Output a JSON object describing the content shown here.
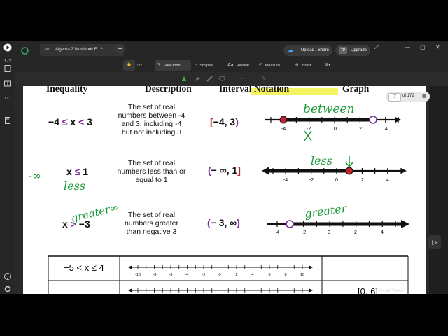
{
  "tab": {
    "title": "Algebra 2 Workbook F... *"
  },
  "actions": {
    "upload": "Upload / Share",
    "upgrade_badge": "TP",
    "upgrade_basic": "Basic",
    "upgrade": "Upgrade"
  },
  "sidebar": {
    "page_count": "172"
  },
  "toolbar": {
    "freeform": "Free-form",
    "shapes": "Shapes",
    "review": "Review",
    "measure": "Measure",
    "insert": "Insert",
    "review_glyph": "Aa"
  },
  "page_indicator": {
    "current": "7",
    "total": "of 172"
  },
  "headers": {
    "inequality": "Inequality",
    "description": "Description",
    "interval": "Interval Notation",
    "graph": "Graph"
  },
  "rows": [
    {
      "ineq_a": "−4 ",
      "ineq_op1": "≤",
      "ineq_b": " x ",
      "ineq_op2": "<",
      "ineq_c": " 3",
      "desc": [
        "The set of real",
        "numbers between -4",
        "and 3, including -4",
        "but not including 3"
      ],
      "int_open": "[",
      "int_body": "−4, 3",
      "int_close": ")",
      "ticks": [
        "-4",
        "-2",
        "0",
        "2",
        "4"
      ]
    },
    {
      "ineq_a": "x ",
      "ineq_op1": "≤",
      "ineq_b": " 1",
      "desc": [
        "The set of real",
        "numbers less than or",
        "equal to 1"
      ],
      "int_open": "(",
      "int_body": "− ∞, 1",
      "int_close": "]",
      "ticks": [
        "-4",
        "-2",
        "0",
        "2",
        "4"
      ]
    },
    {
      "ineq_a": "x ",
      "ineq_op1": ">",
      "ineq_b": " −3",
      "desc": [
        "The set of real",
        "numbers greater",
        "than negative 3"
      ],
      "int_open": "(",
      "int_body": "− 3, ∞",
      "int_close": ")",
      "ticks": [
        "-4",
        "-2",
        "0",
        "2",
        "4"
      ]
    }
  ],
  "table": {
    "row1_ineq": "−5 < x ≤ 4",
    "row2_interval": "[0, 6]",
    "ticks": [
      "-10",
      "-8",
      "-6",
      "-4",
      "-2",
      "0",
      "2",
      "4",
      "6",
      "8",
      "10"
    ]
  },
  "handwriting": {
    "between": "between",
    "less_top": "less",
    "less_left": "less",
    "neg_inf": "-∞",
    "greater_left": "greater∞",
    "greater_right": "greater"
  },
  "watermark": "Create Watch",
  "colors": {
    "accent_purple": "#7a2a9a",
    "accent_red": "#c0262d",
    "ink_green": "#1a9a3a",
    "highlight": "#f5f562"
  }
}
